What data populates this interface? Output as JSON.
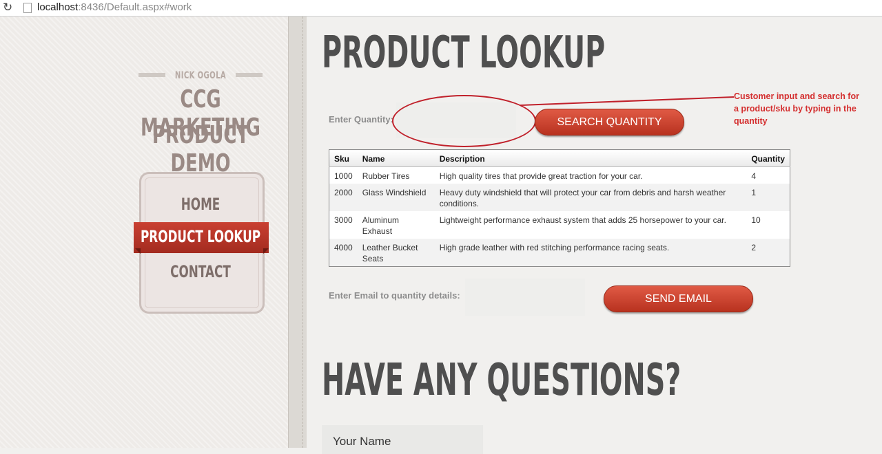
{
  "browser": {
    "url_host": "localhost",
    "url_rest": ":8436/Default.aspx#work"
  },
  "sidebar": {
    "author": "NICK OGOLA",
    "brand_line1": "CCG MARKETING",
    "brand_line2": "PRODUCT DEMO",
    "nav": [
      {
        "label": "HOME"
      },
      {
        "label": "PRODUCT LOOKUP",
        "active": true
      },
      {
        "label": "CONTACT"
      }
    ],
    "accent_color": "#b8321f"
  },
  "main": {
    "title": "PRODUCT LOOKUP",
    "quantity_label": "Enter Quantity:",
    "search_button": "SEARCH QUANTITY",
    "annotation": "Customer input and search for a product/sku by typing in the quantity",
    "table": {
      "headers": [
        "Sku",
        "Name",
        "Description",
        "Quantity"
      ],
      "rows": [
        [
          "1000",
          "Rubber Tires",
          "High quality tires that provide great traction for your car.",
          "4"
        ],
        [
          "2000",
          "Glass Windshield",
          "Heavy duty windshield that will protect your car from debris and harsh weather conditions.",
          "1"
        ],
        [
          "3000",
          "Aluminum Exhaust",
          "Lightweight performance exhaust system that adds 25 horsepower to your car.",
          "10"
        ],
        [
          "4000",
          "Leather Bucket Seats",
          "High grade leather with red stitching performance racing seats.",
          "2"
        ]
      ]
    },
    "email_label": "Enter Email to quantity details:",
    "email_button": "SEND EMAIL",
    "questions_title": "HAVE ANY QUESTIONS?",
    "name_placeholder": "Your Name"
  }
}
